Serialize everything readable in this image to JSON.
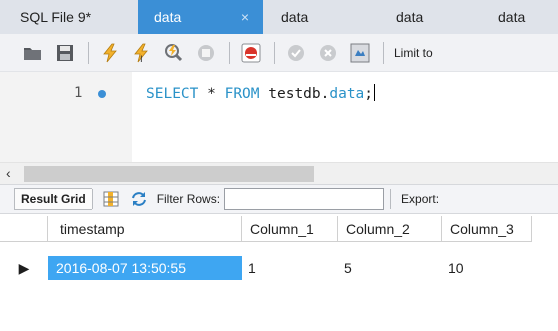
{
  "tabs": [
    {
      "label": "SQL File 9*",
      "active": false
    },
    {
      "label": "data",
      "active": true,
      "close": "×"
    },
    {
      "label": "data",
      "active": false
    },
    {
      "label": "data",
      "active": false
    },
    {
      "label": "data",
      "active": false
    }
  ],
  "toolbar": {
    "icons": [
      "open-folder-icon",
      "save-icon",
      "execute-lightning-icon",
      "execute-selection-icon",
      "explain-magnifier-icon",
      "stop-icon",
      "toggle-error-icon",
      "commit-icon",
      "rollback-icon",
      "autocommit-icon"
    ],
    "limit_label": "Limit to"
  },
  "editor": {
    "line_number": "1",
    "code_keyword_1": "SELECT",
    "code_star": "*",
    "code_keyword_2": "FROM",
    "code_schema": "testdb.",
    "code_table": "data",
    "code_end": ";"
  },
  "result_toolbar": {
    "result_grid_label": "Result Grid",
    "filter_rows_label": "Filter Rows:",
    "filter_value": "",
    "export_label": "Export:"
  },
  "grid": {
    "columns": [
      "timestamp",
      "Column_1",
      "Column_2",
      "Column_3"
    ],
    "rows": [
      {
        "marker": "▶",
        "cells": [
          "2016-08-07 13:50:55",
          "1",
          "5",
          "10"
        ]
      }
    ]
  },
  "colors": {
    "accent": "#3b8fd6",
    "selected_cell": "#3ea6f2",
    "sql_keyword": "#2a92c8"
  }
}
